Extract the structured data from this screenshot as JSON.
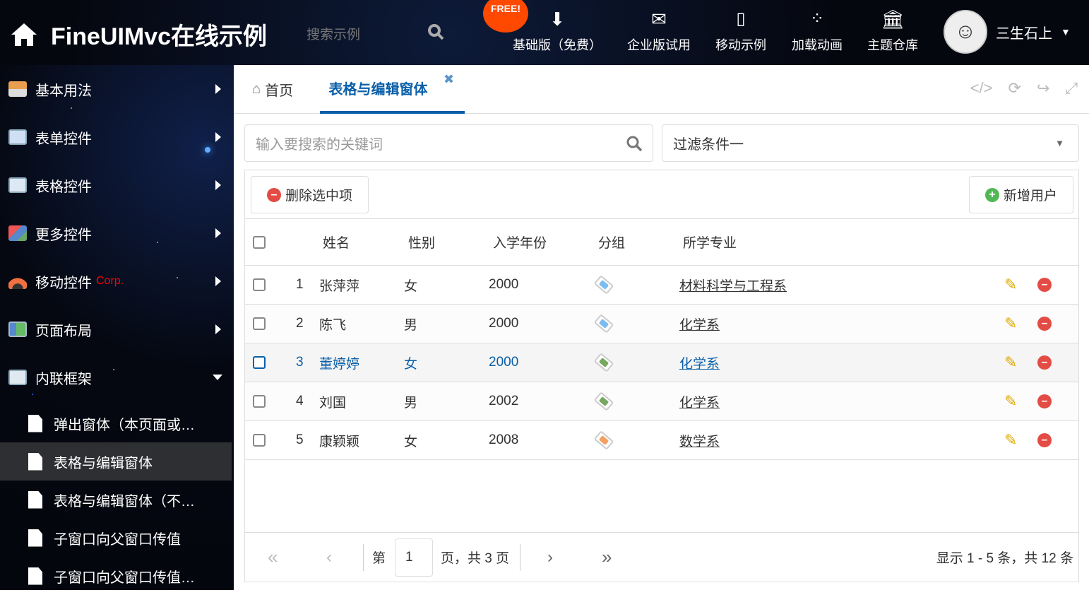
{
  "header": {
    "title": "FineUIMvc在线示例",
    "search_placeholder": "搜索示例",
    "free_badge": "FREE!",
    "nav": [
      {
        "label": "基础版（免费）",
        "icon": "download-icon"
      },
      {
        "label": "企业版试用",
        "icon": "envelope-icon"
      },
      {
        "label": "移动示例",
        "icon": "mobile-icon"
      },
      {
        "label": "加载动画",
        "icon": "spinner-icon"
      },
      {
        "label": "主题仓库",
        "icon": "bank-icon"
      }
    ],
    "user": "三生石上"
  },
  "sidebar": {
    "items": [
      {
        "label": "基本用法",
        "icon": "home-icon"
      },
      {
        "label": "表单控件",
        "icon": "form-icon"
      },
      {
        "label": "表格控件",
        "icon": "table-icon"
      },
      {
        "label": "更多控件",
        "icon": "blocks-icon"
      },
      {
        "label": "移动控件",
        "badge": "Corp.",
        "icon": "radar-icon"
      },
      {
        "label": "页面布局",
        "icon": "layout-icon"
      },
      {
        "label": "内联框架",
        "icon": "windows-icon"
      }
    ],
    "subitems": [
      "弹出窗体（本页面或…",
      "表格与编辑窗体",
      "表格与编辑窗体（不…",
      "子窗口向父窗口传值",
      "子窗口向父窗口传值…"
    ]
  },
  "tabs": {
    "home": "首页",
    "active": "表格与编辑窗体"
  },
  "search": {
    "placeholder": "输入要搜索的关键词",
    "filter": "过滤条件一"
  },
  "toolbar": {
    "delete": "删除选中项",
    "add": "新增用户"
  },
  "grid": {
    "columns": [
      "姓名",
      "性别",
      "入学年份",
      "分组",
      "所学专业"
    ],
    "rows": [
      {
        "n": "1",
        "name": "张萍萍",
        "gender": "女",
        "year": "2000",
        "tag": "#7cbcf0",
        "major": "材料科学与工程系"
      },
      {
        "n": "2",
        "name": "陈飞",
        "gender": "男",
        "year": "2000",
        "tag": "#7cbcf0",
        "major": "化学系"
      },
      {
        "n": "3",
        "name": "董婷婷",
        "gender": "女",
        "year": "2000",
        "tag": "#78a860",
        "major": "化学系"
      },
      {
        "n": "4",
        "name": "刘国",
        "gender": "男",
        "year": "2002",
        "tag": "#78a860",
        "major": "化学系"
      },
      {
        "n": "5",
        "name": "康颖颖",
        "gender": "女",
        "year": "2008",
        "tag": "#f5a060",
        "major": "数学系"
      }
    ]
  },
  "pager": {
    "prefix": "第",
    "page": "1",
    "suffix": "页，共 3 页",
    "summary": "显示 1 - 5 条，共 12 条"
  }
}
